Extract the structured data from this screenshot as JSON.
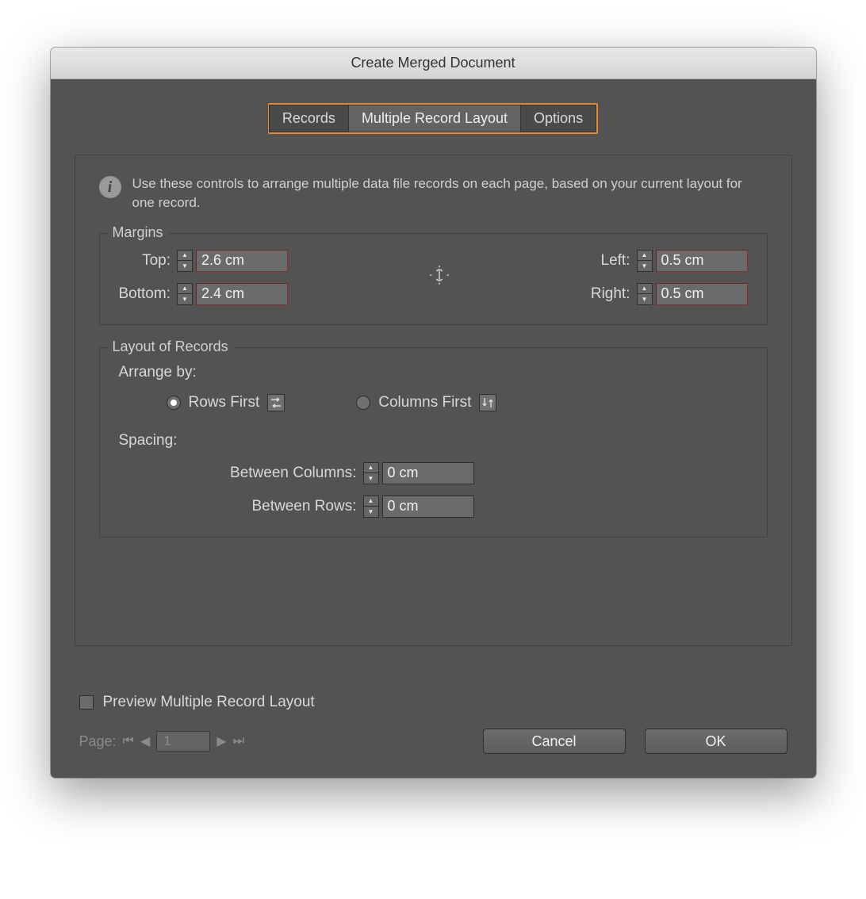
{
  "title": "Create Merged Document",
  "tabs": {
    "records": "Records",
    "multiple": "Multiple Record Layout",
    "options": "Options"
  },
  "info": {
    "glyph": "i",
    "text": "Use these controls to arrange multiple data file records on each page, based on your current layout for one record."
  },
  "margins": {
    "legend": "Margins",
    "labels": {
      "top": "Top:",
      "bottom": "Bottom:",
      "left": "Left:",
      "right": "Right:"
    },
    "values": {
      "top": "2.6 cm",
      "bottom": "2.4 cm",
      "left": "0.5 cm",
      "right": "0.5 cm"
    }
  },
  "layout": {
    "legend": "Layout of Records",
    "arrange_label": "Arrange by:",
    "rows_first": "Rows First",
    "columns_first": "Columns First",
    "spacing_label": "Spacing:",
    "between_columns_label": "Between Columns:",
    "between_rows_label": "Between Rows:",
    "between_columns_value": "0 cm",
    "between_rows_value": "0 cm"
  },
  "preview_label": "Preview Multiple Record Layout",
  "page": {
    "label": "Page:",
    "value": "1"
  },
  "buttons": {
    "cancel": "Cancel",
    "ok": "OK"
  }
}
